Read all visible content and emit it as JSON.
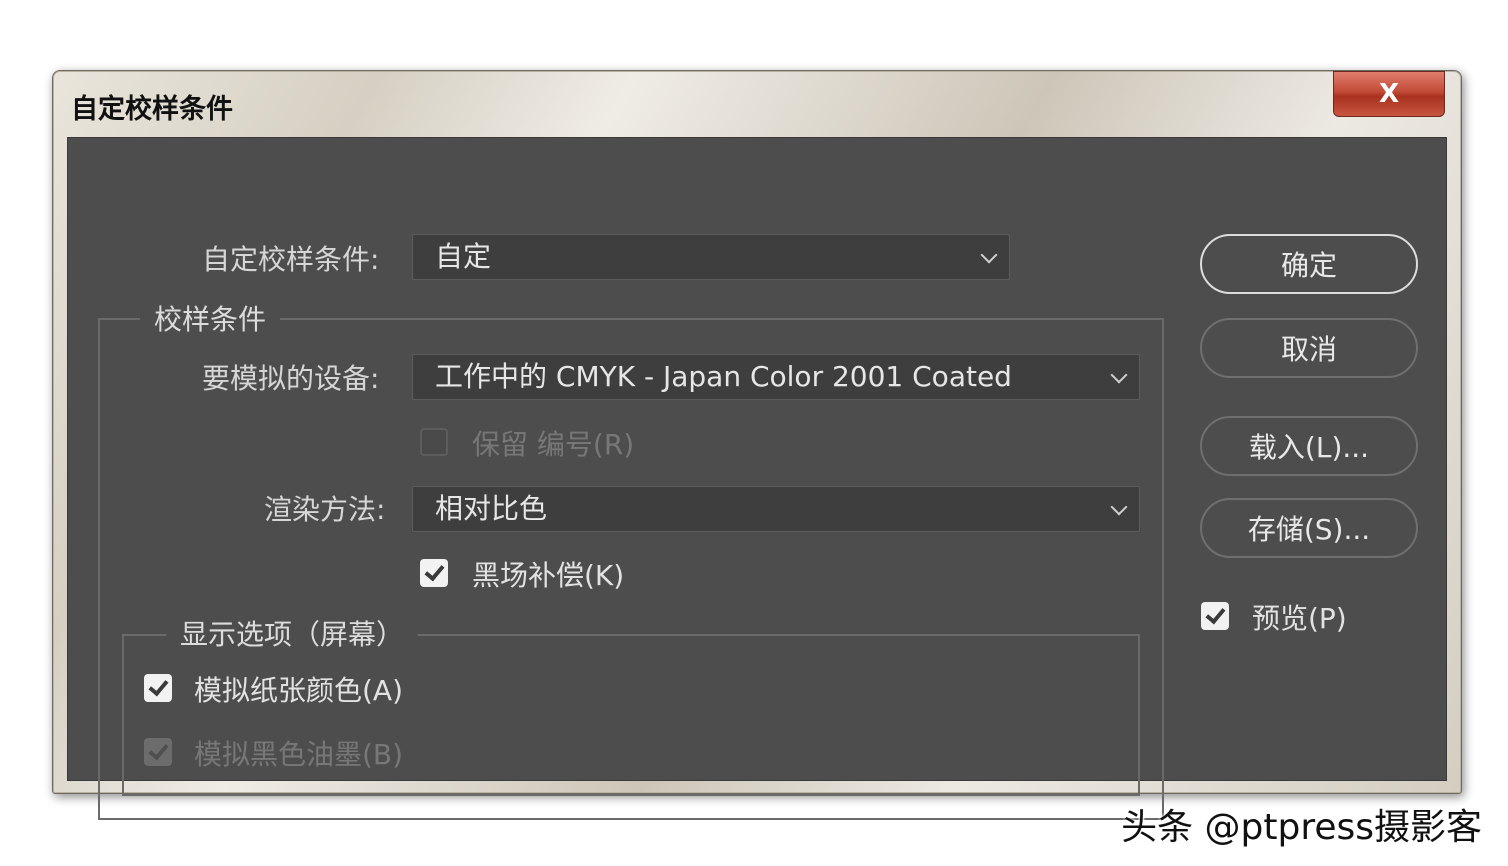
{
  "window": {
    "title": "自定校样条件",
    "close_label": "X"
  },
  "form": {
    "custom_label": "自定校样条件:",
    "custom_value": "自定",
    "group_title": "校样条件",
    "device_label": "要模拟的设备:",
    "device_value": "工作中的 CMYK - Japan Color 2001 Coated",
    "preserve_label": "保留 编号(R)",
    "preserve_checked": false,
    "preserve_enabled": false,
    "render_label": "渲染方法:",
    "render_value": "相对比色",
    "bpc_label": "黑场补偿(K)",
    "bpc_checked": true,
    "display_group_title": "显示选项（屏幕）",
    "paper_label": "模拟纸张颜色(A)",
    "paper_checked": true,
    "ink_label": "模拟黑色油墨(B)",
    "ink_checked": true,
    "ink_enabled": false
  },
  "buttons": {
    "ok": "确定",
    "cancel": "取消",
    "load": "载入(L)...",
    "save": "存储(S)..."
  },
  "preview": {
    "label": "预览(P)",
    "checked": true
  },
  "watermark": "头条 @ptpress摄影客",
  "colors": {
    "panel_bg": "#4d4d4d",
    "close_button": "#c24a36",
    "title_bar": "#d6d0c3"
  }
}
